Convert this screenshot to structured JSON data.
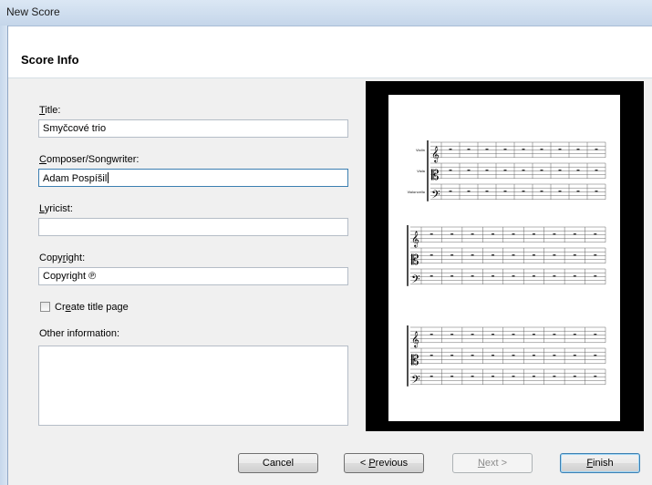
{
  "window": {
    "title": "New Score"
  },
  "header": {
    "title": "Score Info"
  },
  "form": {
    "title_label": "Title:",
    "title_value": "Smyčcové trio",
    "composer_label": "Composer/Songwriter:",
    "composer_value": "Adam Pospíšil",
    "lyricist_label": "Lyricist:",
    "lyricist_value": "",
    "copyright_label": "Copyright:",
    "copyright_value": "Copyright ℗",
    "create_title_page_label": "Create title page",
    "create_title_page_checked": false,
    "other_info_label": "Other information:",
    "other_info_value": ""
  },
  "preview": {
    "instruments": [
      "Violin",
      "Viola",
      "Violoncello"
    ]
  },
  "buttons": {
    "cancel": "Cancel",
    "previous": "< Previous",
    "next": "Next >",
    "finish": "Finish"
  }
}
